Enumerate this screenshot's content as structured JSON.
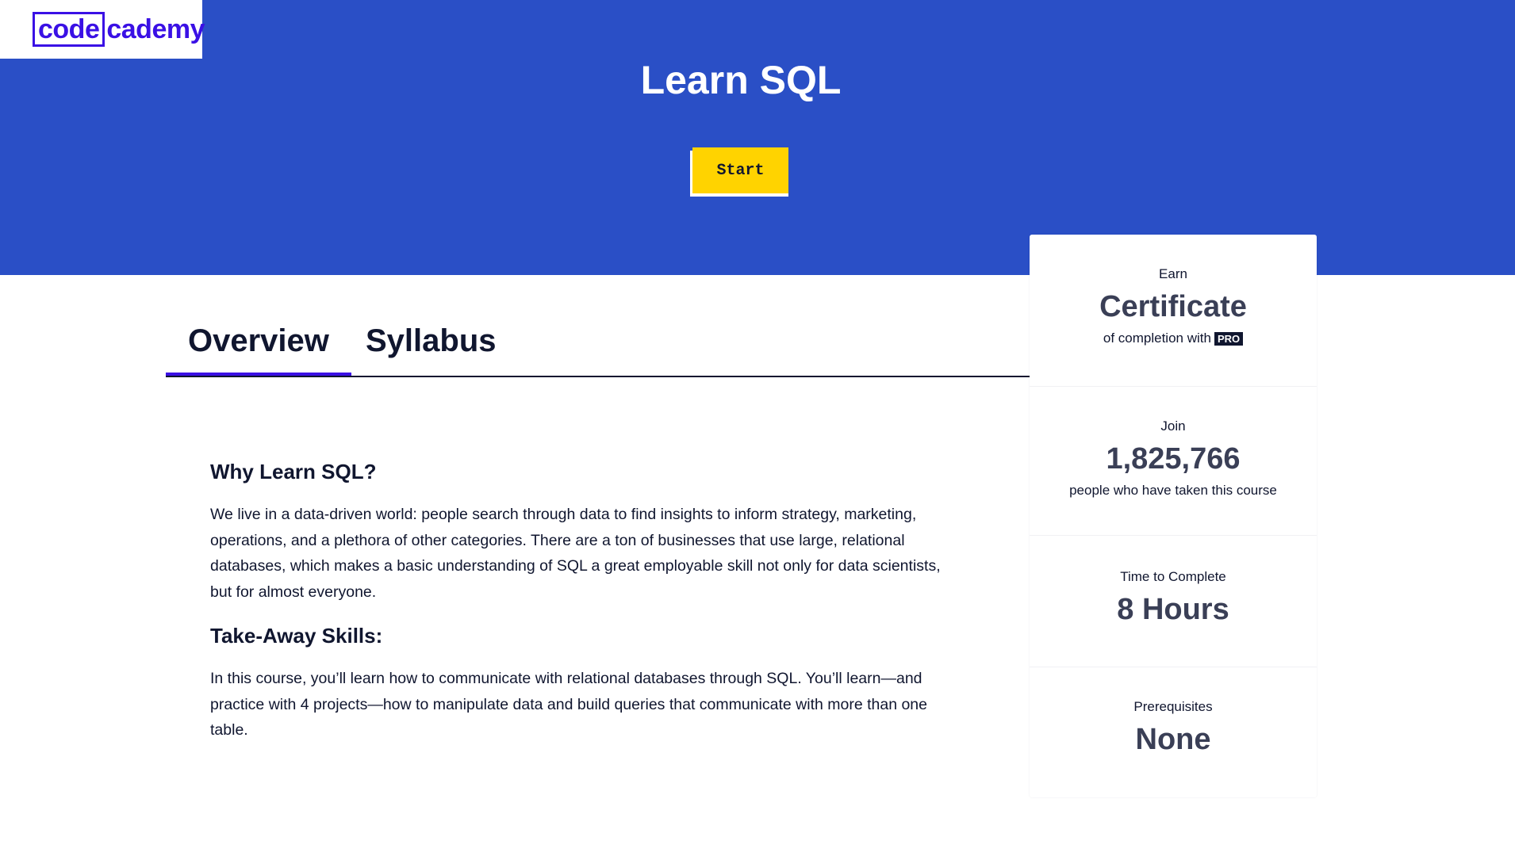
{
  "brand": {
    "logo_boxed": "code",
    "logo_rest": "cademy",
    "color": "#3a10e5"
  },
  "hero": {
    "title": "Learn SQL",
    "start_label": "Start",
    "background": "#2a4fc6",
    "button_color": "#ffd300"
  },
  "tabs": [
    {
      "label": "Overview",
      "active": true
    },
    {
      "label": "Syllabus",
      "active": false
    }
  ],
  "overview": {
    "heading1": "Why Learn SQL?",
    "para1": "We live in a data-driven world: people search through data to find insights to inform strategy, marketing, operations, and a plethora of other categories. There are a ton of businesses that use large, relational databases, which makes a basic understanding of SQL a great employable skill not only for data scientists, but for almost everyone.",
    "heading2": "Take-Away Skills:",
    "para2": "In this course, you’ll learn how to communicate with relational databases through SQL. You’ll learn—and practice with 4 projects—how to manipulate data and build queries that communicate with more than one table."
  },
  "stats": {
    "earn": {
      "label": "Earn",
      "value": "Certificate",
      "sub": "of completion with",
      "badge": "PRO"
    },
    "join": {
      "label": "Join",
      "value": "1,825,766",
      "sub": "people who have taken this course"
    },
    "time": {
      "label": "Time to Complete",
      "value": "8 Hours"
    },
    "prereq": {
      "label": "Prerequisites",
      "value": "None"
    }
  }
}
